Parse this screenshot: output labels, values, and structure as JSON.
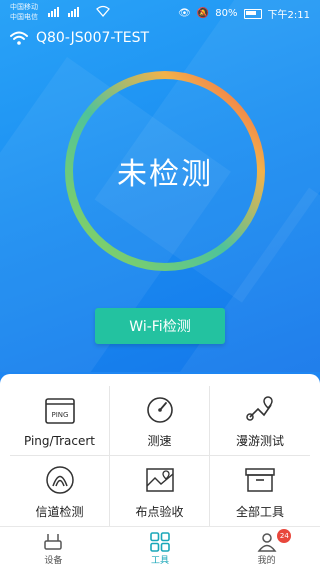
{
  "status_bar": {
    "carrier1": "中国移动",
    "carrier2": "中国电信",
    "battery": "80%",
    "time": "下午2:11",
    "signal1_label": "4G",
    "signal2_label": "2G"
  },
  "header": {
    "device_name": "Q80-JS007-TEST"
  },
  "gauge": {
    "status_text": "未检测",
    "progress_fraction": 0.0
  },
  "primary_button": {
    "label": "Wi-Fi检测"
  },
  "tools": [
    {
      "label": "Ping/Tracert",
      "icon": "ping-icon"
    },
    {
      "label": "测速",
      "icon": "speedometer-icon"
    },
    {
      "label": "漫游测试",
      "icon": "roaming-route-icon"
    },
    {
      "label": "信道检测",
      "icon": "channel-signal-icon"
    },
    {
      "label": "布点验收",
      "icon": "map-pin-icon"
    },
    {
      "label": "全部工具",
      "icon": "archive-box-icon"
    }
  ],
  "tabbar": {
    "tabs": [
      {
        "label": "设备",
        "icon": "router-icon",
        "active": false
      },
      {
        "label": "工具",
        "icon": "grid-icon",
        "active": true
      },
      {
        "label": "我的",
        "icon": "user-icon",
        "active": false
      }
    ],
    "badge_text": "24"
  },
  "colors": {
    "primary_blue": "#1b8ff2",
    "button_teal": "#23c2a0",
    "active_tab": "#1aa7b9",
    "ring_start": "#8fd35a",
    "ring_end": "#f2604a"
  }
}
